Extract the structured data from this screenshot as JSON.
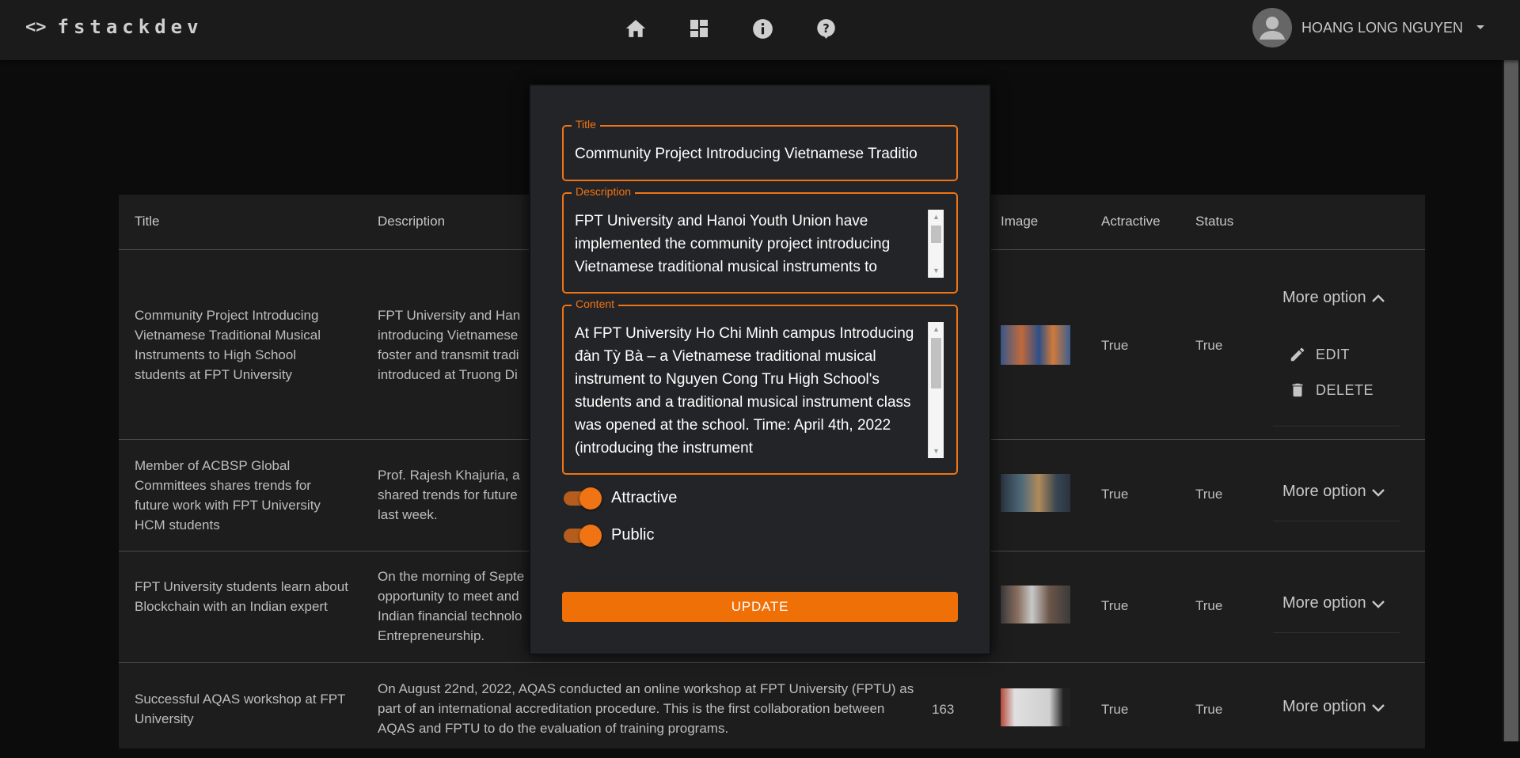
{
  "app": {
    "brand_icon": "<>",
    "brand": "fstackdev",
    "nav_icons": [
      "home-icon",
      "dashboard-icon",
      "info-icon",
      "help-icon"
    ],
    "user_name": "HOANG LONG NGUYEN"
  },
  "colors": {
    "accent": "#f07414",
    "appbar": "#1b1b1b",
    "dialog": "#232427",
    "table": "#1d1d1d"
  },
  "table": {
    "headers": [
      "Title",
      "Description",
      "Image",
      "Actractive",
      "Status"
    ],
    "rows": [
      {
        "title": "Community Project Introducing Vietnamese Traditional Musical Instruments to High School students at FPT University",
        "description": "FPT University and Han introducing Vietnamese foster and transmit tradi introduced at Truong Di",
        "views": "",
        "attractive": "True",
        "status": "True",
        "more": "More option",
        "expanded": true,
        "edit": "EDIT",
        "delete": "DELETE"
      },
      {
        "title": "Member of ACBSP Global Committees shares trends for future work with FPT University HCM students",
        "description": "Prof. Rajesh Khajuria, a shared trends for future last week.",
        "views": "",
        "attractive": "True",
        "status": "True",
        "more": "More option",
        "expanded": false
      },
      {
        "title": "FPT University students learn about Blockchain with an Indian expert",
        "description": "On the morning of Septe opportunity to meet and Indian financial technolo Entrepreneurship.",
        "views": "",
        "attractive": "True",
        "status": "True",
        "more": "More option",
        "expanded": false
      },
      {
        "title": "Successful AQAS workshop at FPT University",
        "description": "On August 22nd, 2022, AQAS conducted an online workshop at FPT University (FPTU) as part of an international accreditation procedure. This is the first collaboration between AQAS and FPTU to do the evaluation of training programs.",
        "views": "163",
        "attractive": "True",
        "status": "True",
        "more": "More option",
        "expanded": false
      }
    ]
  },
  "dialog": {
    "title_label": "Title",
    "title_value": "Community Project Introducing Vietnamese Traditio",
    "description_label": "Description",
    "description_value": "FPT University and Hanoi Youth Union have implemented the community project introducing Vietnamese traditional musical instruments to",
    "content_label": "Content",
    "content_value": "At FPT University Ho Chi Minh campus Introducing đàn Tỳ Bà – a Vietnamese traditional musical instrument to Nguyen Cong Tru High School's students and a traditional musical instrument class was opened at the school. Time: April 4th, 2022 (introducing the instrument",
    "attractive_label": "Attractive",
    "attractive_on": true,
    "public_label": "Public",
    "public_on": true,
    "update_label": "UPDATE"
  }
}
